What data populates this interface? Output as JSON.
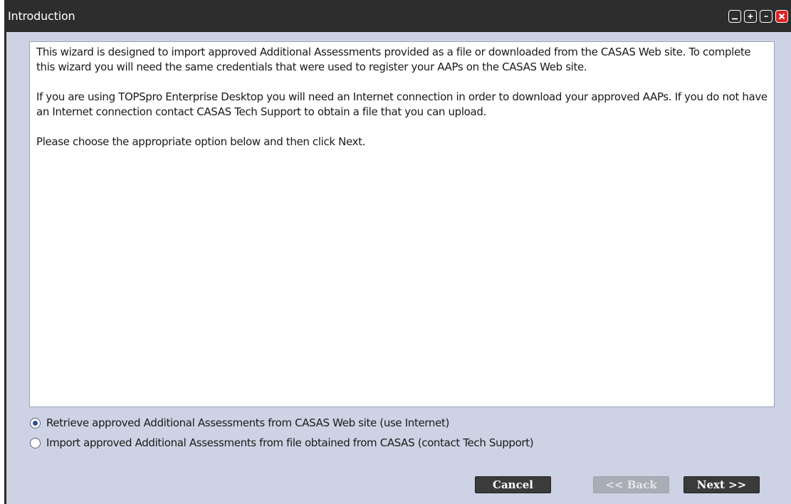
{
  "window": {
    "title": "Introduction",
    "controls": [
      "minimize-icon",
      "plus-icon",
      "minus-icon",
      "close-icon"
    ]
  },
  "intro": {
    "paragraphs": [
      "This wizard is designed to import approved Additional Assessments provided as a file or downloaded from the CASAS Web site. To complete this wizard you will need the same credentials that were used to register your AAPs on the CASAS Web site.",
      "If you are using TOPSpro Enterprise Desktop you will need an Internet connection in order to download your approved AAPs. If you do not have an Internet connection contact CASAS Tech Support to obtain a file that you can upload.",
      "Please choose the appropriate option below and then click Next."
    ]
  },
  "options": {
    "retrieve_label": "Retrieve approved Additional Assessments from CASAS Web site (use Internet)",
    "import_label": "Import approved Additional Assessments from file obtained from CASAS (contact Tech Support)",
    "selected": "retrieve"
  },
  "buttons": {
    "cancel": "Cancel",
    "back": "<< Back",
    "next": "Next >>",
    "back_enabled": false
  },
  "colors": {
    "titlebar": "#2d2d2d",
    "window_bg": "#cdd3e4",
    "close_button": "#d62424",
    "button_dark": "#3b3b3b",
    "button_disabled": "#a9adb6",
    "radio_selected": "#2b4f9e"
  }
}
